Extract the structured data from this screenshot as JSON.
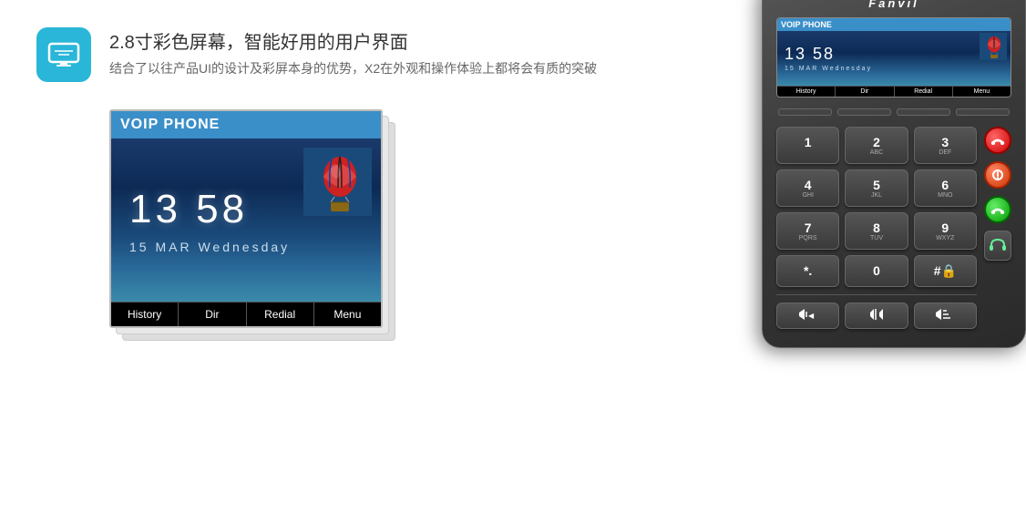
{
  "feature": {
    "icon_label": "screen-icon",
    "title": "2.8寸彩色屏幕，智能好用的用户界面",
    "description": "结合了以往产品UI的设计及彩屏本身的优势，X2在外观和操作体验上都将会有质的突破"
  },
  "phone_screen": {
    "header": "VOIP  PHONE",
    "time": "13  58",
    "date": "15   MAR   Wednesday",
    "buttons": [
      "History",
      "Dir",
      "Redial",
      "Menu"
    ]
  },
  "device": {
    "brand": "Fanvil",
    "mini_screen": {
      "header": "VOIP  PHONE",
      "time": "13 58",
      "date": "15  MAR  Wednesday",
      "buttons": [
        "History",
        "Dir",
        "Redial",
        "Menu"
      ]
    },
    "keypad": [
      {
        "main": "1",
        "sub": ""
      },
      {
        "main": "2",
        "sub": "ABC"
      },
      {
        "main": "3",
        "sub": "DEF"
      },
      {
        "main": "4",
        "sub": "GHI"
      },
      {
        "main": "5",
        "sub": "JKL"
      },
      {
        "main": "6",
        "sub": "MNO"
      },
      {
        "main": "7",
        "sub": "PQRS"
      },
      {
        "main": "8",
        "sub": "TUV"
      },
      {
        "main": "9",
        "sub": "WXYZ"
      },
      {
        "main": "*.",
        "sub": ""
      },
      {
        "main": "0",
        "sub": ""
      },
      {
        "main": "#",
        "sub": "🔒"
      }
    ],
    "bottom_keys": [
      "< ◀",
      "(◀)",
      "▶ >"
    ],
    "headset_icon": "🎧"
  }
}
